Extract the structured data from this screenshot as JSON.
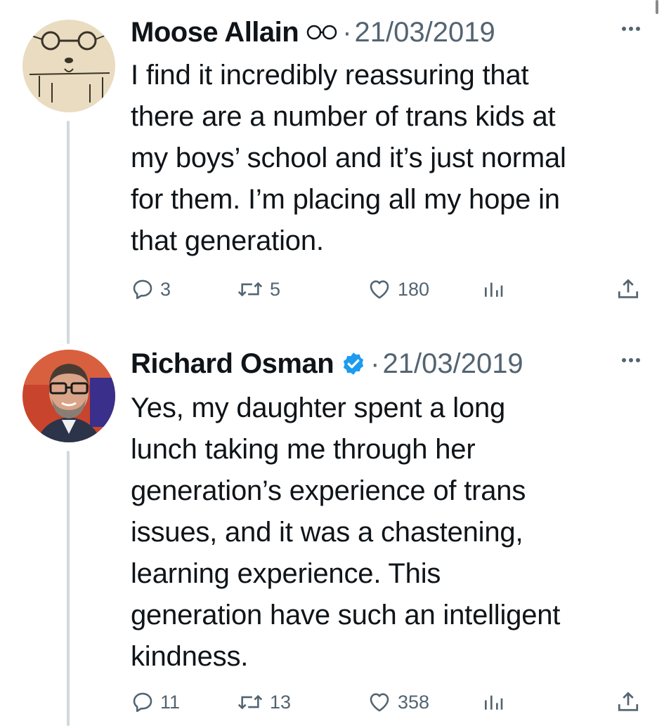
{
  "tweets": [
    {
      "author": "Moose Allain",
      "badge": "glasses-emoji-icon",
      "separator": "·",
      "date": "21/03/2019",
      "text": "I find it incredibly reassuring that\nthere are a number of trans kids at\nmy boys’ school and it’s just normal\nfor them. I’m placing all my hope in\nthat generation.",
      "replies": "3",
      "retweets": "5",
      "likes": "180",
      "avatar": "sketch-drawing-avatar"
    },
    {
      "author": "Richard Osman",
      "badge": "verified-badge-icon",
      "separator": "·",
      "date": "21/03/2019",
      "text": "Yes, my daughter spent a long\nlunch taking me through her\ngeneration’s experience of trans\nissues, and it was a chastening,\nlearning experience. This\ngeneration have such an intelligent\nkindness.",
      "replies": "11",
      "retweets": "13",
      "likes": "358",
      "avatar": "man-with-glasses-photo-avatar"
    }
  ],
  "colors": {
    "text": "#0f1419",
    "secondary": "#536471",
    "verified": "#1d9bf0",
    "thread_line": "#cfd9de"
  }
}
